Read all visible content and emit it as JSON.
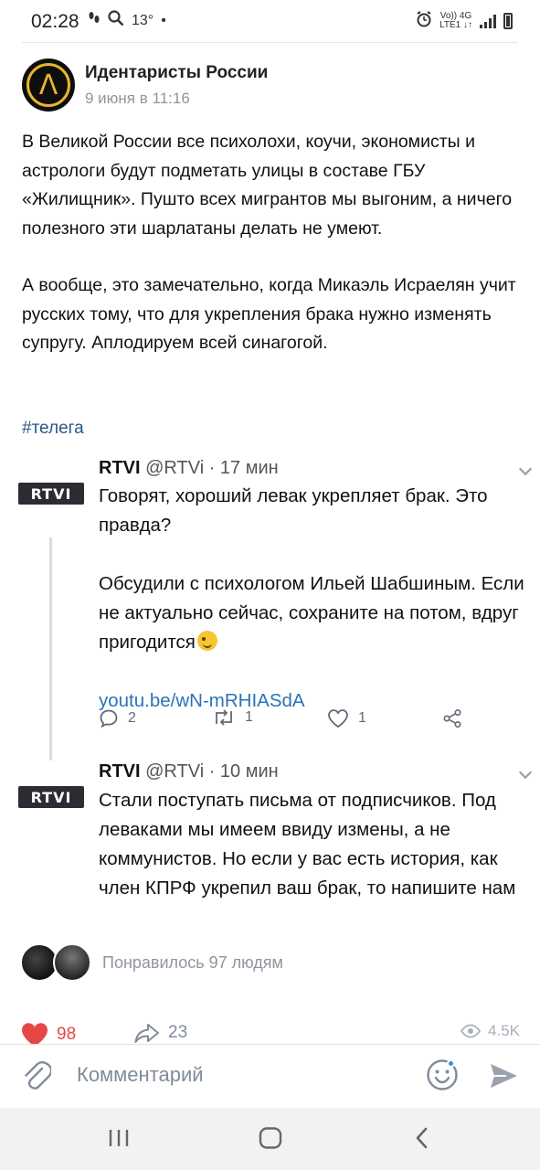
{
  "status_bar": {
    "time": "02:28",
    "temperature": "13°",
    "dot": "•",
    "network_top": "Vo)) 4G",
    "network_bottom": "LTE1 ↓↑"
  },
  "post": {
    "group_name": "Идентаристы России",
    "date": "9 июня в 11:16",
    "paragraphs": [
      "В Великой России все психолохи, коучи, экономисты и астрологи будут подметать улицы в составе ГБУ «Жилищник». Пушто всех мигрантов мы выгоним, а ничего полезного эти шарлатаны делать не умеют.",
      "А вообще, это замечательно, когда Микаэль Исраелян учит русских тому, что для укрепления брака нужно изменять супругу. Аплодируем всей синагогой."
    ],
    "hashtag": "#телега"
  },
  "tweets": [
    {
      "logo": "RTVI",
      "name": "RTVI",
      "handle": "@RTVi · 17 мин",
      "para1": "Говорят, хороший левак укрепляет брак. Это правда?",
      "para2": "Обсудили с психологом Ильей Шабшиным. Если не актуально сейчас, сохраните на потом, вдруг пригодится",
      "link": "youtu.be/wN-mRHIASdA",
      "replies": "2",
      "retweets": "1",
      "likes": "1"
    },
    {
      "logo": "RTVI",
      "name": "RTVI",
      "handle": "@RTVi · 10 мин",
      "text": "Стали поступать письма от подписчиков. Под леваками мы имеем ввиду измены, а не коммунистов. Но если у вас есть история, как член КПРФ укрепил ваш брак, то напишите нам"
    }
  ],
  "likes_summary": "Понравилось 97 людям",
  "actions": {
    "likes": "98",
    "shares": "23",
    "views": "4.5K"
  },
  "comment": {
    "placeholder": "Комментарий"
  },
  "colors": {
    "link": "#2a5885",
    "like_red": "#e64646",
    "accent_gold": "#e9b52b",
    "muted": "#818c99"
  }
}
